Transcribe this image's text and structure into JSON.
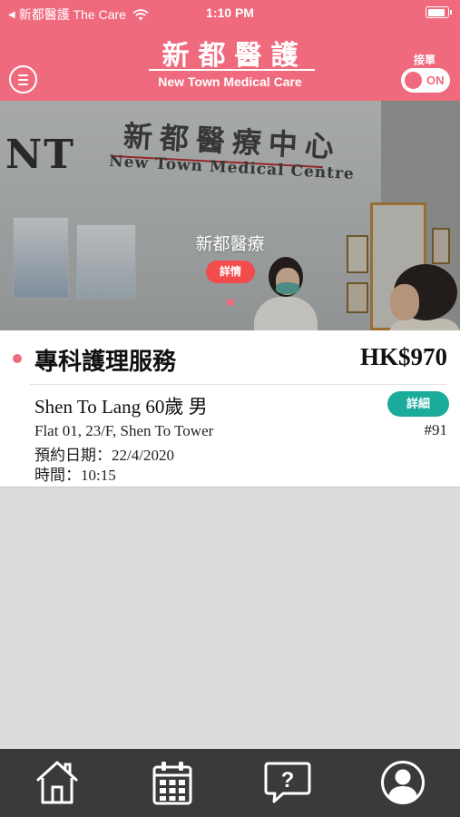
{
  "status_bar": {
    "back_app": "新都醫護 The Care",
    "time": "1:10 PM",
    "battery_level": 0.9
  },
  "header": {
    "title_zh": "新都醫護",
    "title_en": "New Town Medical Care",
    "toggle_label": "接單",
    "toggle_state": "ON",
    "accent_color": "#ef6a7d"
  },
  "banner": {
    "logo_text": "NT",
    "sign_zh": "新都醫療中心",
    "sign_en": "New Town Medical Centre",
    "title": "新都醫療",
    "detail_button": "詳情",
    "page_count": 1,
    "current_page": 1
  },
  "order_card": {
    "service": "專科護理服務",
    "price": "HK$970",
    "patient": "Shen To Lang 60歲 男",
    "address": "Flat 01, 23/F, Shen To Tower",
    "date": "預約日期：22/4/2020",
    "time": "時間：10:15",
    "detail_button": "詳細",
    "order_number": "#91",
    "button_color": "#1aab9b"
  },
  "bottom_nav": {
    "items": [
      {
        "icon": "home-icon"
      },
      {
        "icon": "calendar-icon"
      },
      {
        "icon": "help-chat-icon"
      },
      {
        "icon": "profile-icon"
      }
    ]
  }
}
